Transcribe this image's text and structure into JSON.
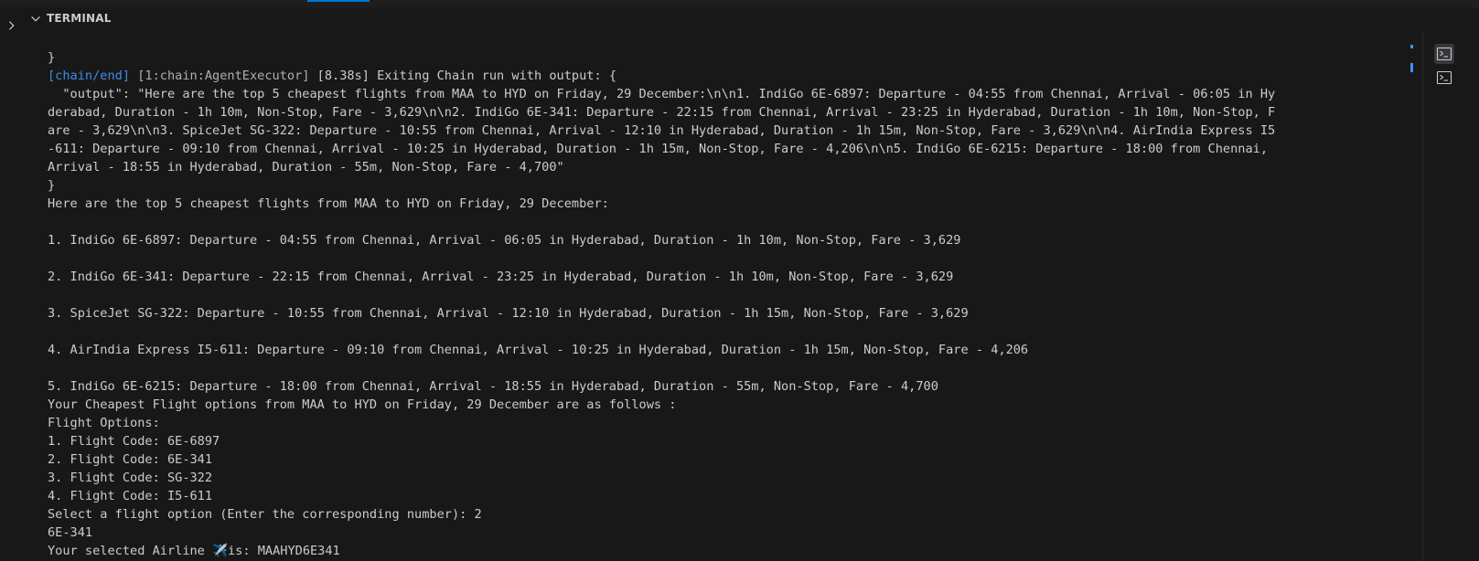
{
  "panel": {
    "title": "TERMINAL"
  },
  "terminal": {
    "lines": [
      [
        {
          "text": "}"
        }
      ],
      [
        {
          "text": "[chain/end]",
          "color": "blue"
        },
        {
          "text": " [1:chain:AgentExecutor]",
          "style": "dim"
        },
        {
          "text": " [8.38s] Exiting Chain run with output: {"
        }
      ],
      [
        {
          "text": "  \"output\": \"Here are the top 5 cheapest flights from MAA to HYD on Friday, 29 December:\\n\\n1. IndiGo 6E-6897: Departure - 04:55 from Chennai, Arrival - 06:05 in Hy"
        }
      ],
      [
        {
          "text": "derabad, Duration - 1h 10m, Non-Stop, Fare - 3,629\\n\\n2. IndiGo 6E-341: Departure - 22:15 from Chennai, Arrival - 23:25 in Hyderabad, Duration - 1h 10m, Non-Stop, F"
        }
      ],
      [
        {
          "text": "are - 3,629\\n\\n3. SpiceJet SG-322: Departure - 10:55 from Chennai, Arrival - 12:10 in Hyderabad, Duration - 1h 15m, Non-Stop, Fare - 3,629\\n\\n4. AirIndia Express I5"
        }
      ],
      [
        {
          "text": "-611: Departure - 09:10 from Chennai, Arrival - 10:25 in Hyderabad, Duration - 1h 15m, Non-Stop, Fare - 4,206\\n\\n5. IndiGo 6E-6215: Departure - 18:00 from Chennai,"
        }
      ],
      [
        {
          "text": "Arrival - 18:55 in Hyderabad, Duration - 55m, Non-Stop, Fare - 4,700\""
        }
      ],
      [
        {
          "text": "}"
        }
      ],
      [
        {
          "text": "Here are the top 5 cheapest flights from MAA to HYD on Friday, 29 December:"
        }
      ],
      [
        {
          "text": ""
        }
      ],
      [
        {
          "text": "1. IndiGo 6E-6897: Departure - 04:55 from Chennai, Arrival - 06:05 in Hyderabad, Duration - 1h 10m, Non-Stop, Fare - 3,629"
        }
      ],
      [
        {
          "text": ""
        }
      ],
      [
        {
          "text": "2. IndiGo 6E-341: Departure - 22:15 from Chennai, Arrival - 23:25 in Hyderabad, Duration - 1h 10m, Non-Stop, Fare - 3,629"
        }
      ],
      [
        {
          "text": ""
        }
      ],
      [
        {
          "text": "3. SpiceJet SG-322: Departure - 10:55 from Chennai, Arrival - 12:10 in Hyderabad, Duration - 1h 15m, Non-Stop, Fare - 3,629"
        }
      ],
      [
        {
          "text": ""
        }
      ],
      [
        {
          "text": "4. AirIndia Express I5-611: Departure - 09:10 from Chennai, Arrival - 10:25 in Hyderabad, Duration - 1h 15m, Non-Stop, Fare - 4,206"
        }
      ],
      [
        {
          "text": ""
        }
      ],
      [
        {
          "text": "5. IndiGo 6E-6215: Departure - 18:00 from Chennai, Arrival - 18:55 in Hyderabad, Duration - 55m, Non-Stop, Fare - 4,700"
        }
      ],
      [
        {
          "text": "Your Cheapest Flight options from MAA to HYD on Friday, 29 December are as follows :"
        }
      ],
      [
        {
          "text": "Flight Options:"
        }
      ],
      [
        {
          "text": "1. Flight Code: 6E-6897"
        }
      ],
      [
        {
          "text": "2. Flight Code: 6E-341"
        }
      ],
      [
        {
          "text": "3. Flight Code: SG-322"
        }
      ],
      [
        {
          "text": "4. Flight Code: I5-611"
        }
      ],
      [
        {
          "text": "Select a flight option (Enter the corresponding number): 2"
        }
      ],
      [
        {
          "text": "6E-341"
        }
      ],
      [
        {
          "text": "Your selected Airline ✈️is: MAAHYD6E341"
        }
      ]
    ]
  },
  "side_terminals": [
    {
      "icon": "terminal-icon",
      "active": true
    },
    {
      "icon": "terminal-icon",
      "active": false
    }
  ],
  "colors": {
    "background": "#181818",
    "text": "#cccccc",
    "blue": "#3b8eea",
    "accent": "#0078d4"
  }
}
